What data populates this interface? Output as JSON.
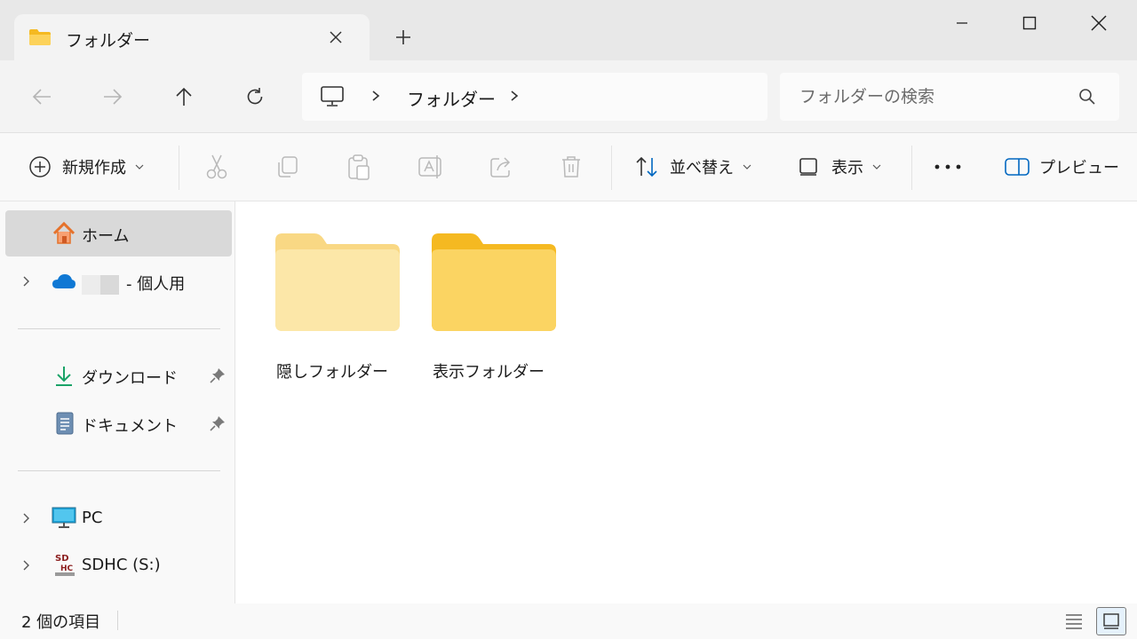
{
  "window": {
    "tab_title": "フォルダー",
    "tab_icon": "folder-icon"
  },
  "navbar": {
    "breadcrumb": "フォルダー",
    "search_placeholder": "フォルダーの検索"
  },
  "commandbar": {
    "new_label": "新規作成",
    "sort_label": "並べ替え",
    "view_label": "表示",
    "preview_label": "プレビュー"
  },
  "sidebar": {
    "home": "ホーム",
    "onedrive_suffix": "- 個人用",
    "downloads": "ダウンロード",
    "documents": "ドキュメント",
    "pc": "PC",
    "sdhc": "SDHC (S:)"
  },
  "content": {
    "items": [
      {
        "label": "隠しフォルダー",
        "hidden": true
      },
      {
        "label": "表示フォルダー",
        "hidden": false
      }
    ]
  },
  "statusbar": {
    "item_count": "2 個の項目"
  },
  "colors": {
    "folder": "#f8c33a",
    "folder_hidden": "#fbe6a8",
    "accent": "#0067c0"
  }
}
